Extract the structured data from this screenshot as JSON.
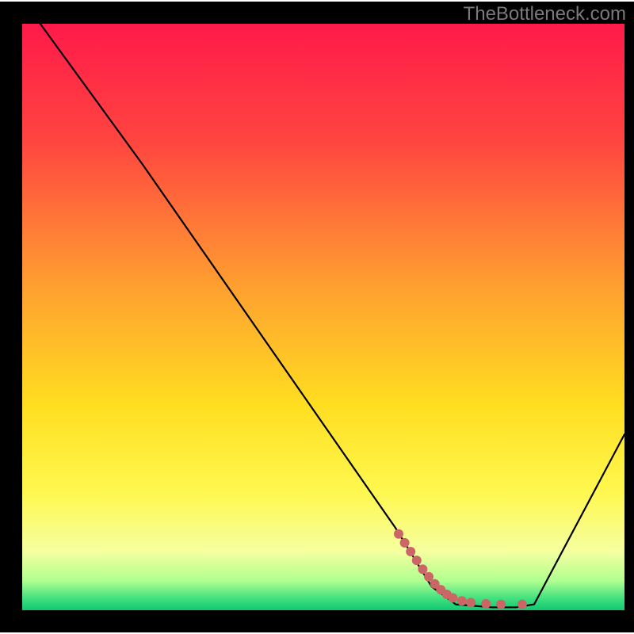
{
  "watermark": "TheBottleneck.com",
  "chart_data": {
    "type": "line",
    "title": "",
    "xlabel": "",
    "ylabel": "",
    "xlim": [
      0,
      100
    ],
    "ylim": [
      0,
      100
    ],
    "series": [
      {
        "name": "curve",
        "points": [
          {
            "x": 3,
            "y": 100
          },
          {
            "x": 20,
            "y": 76
          },
          {
            "x": 62,
            "y": 14
          },
          {
            "x": 68,
            "y": 4
          },
          {
            "x": 72,
            "y": 1
          },
          {
            "x": 78,
            "y": 0.5
          },
          {
            "x": 82,
            "y": 0.5
          },
          {
            "x": 85,
            "y": 1
          },
          {
            "x": 100,
            "y": 30
          }
        ]
      },
      {
        "name": "highlight-dots",
        "points": [
          {
            "x": 62.5,
            "y": 13
          },
          {
            "x": 63.5,
            "y": 11.5
          },
          {
            "x": 64.5,
            "y": 10
          },
          {
            "x": 65.5,
            "y": 8.5
          },
          {
            "x": 66.5,
            "y": 7
          },
          {
            "x": 67.5,
            "y": 5.7
          },
          {
            "x": 68.5,
            "y": 4.5
          },
          {
            "x": 69.5,
            "y": 3.5
          },
          {
            "x": 70.5,
            "y": 2.7
          },
          {
            "x": 71.5,
            "y": 2.1
          },
          {
            "x": 73,
            "y": 1.6
          },
          {
            "x": 74.5,
            "y": 1.3
          },
          {
            "x": 77,
            "y": 1.1
          },
          {
            "x": 79.5,
            "y": 1.0
          },
          {
            "x": 83,
            "y": 1.0
          }
        ]
      }
    ],
    "gradient_stops": [
      {
        "offset": 0,
        "color": "#ff1a4a"
      },
      {
        "offset": 20,
        "color": "#ff4540"
      },
      {
        "offset": 45,
        "color": "#ffa030"
      },
      {
        "offset": 65,
        "color": "#ffde20"
      },
      {
        "offset": 80,
        "color": "#fff850"
      },
      {
        "offset": 90,
        "color": "#f5ffa0"
      },
      {
        "offset": 95,
        "color": "#b0ff90"
      },
      {
        "offset": 98,
        "color": "#40e080"
      },
      {
        "offset": 100,
        "color": "#10c870"
      }
    ],
    "dot_color": "#cc6666",
    "line_color": "#000000",
    "border_color": "#000000"
  }
}
